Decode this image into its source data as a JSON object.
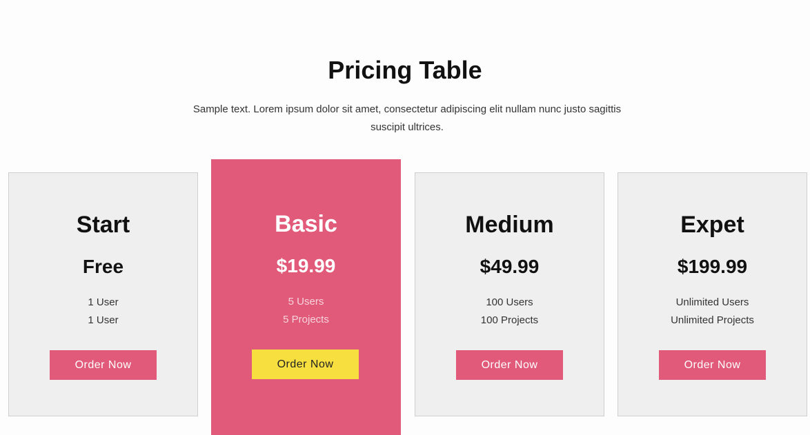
{
  "header": {
    "title": "Pricing Table",
    "subtitle": "Sample text. Lorem ipsum dolor sit amet, consectetur adipiscing elit nullam nunc justo sagittis suscipit ultrices."
  },
  "colors": {
    "accent": "#e15a79",
    "highlight_button": "#f7df3f",
    "card_background": "#efefef"
  },
  "plans": [
    {
      "name": "Start",
      "price": "Free",
      "features": [
        "1 User",
        "1 User"
      ],
      "button": "Order Now",
      "featured": false
    },
    {
      "name": "Basic",
      "price": "$19.99",
      "features": [
        "5 Users",
        "5 Projects"
      ],
      "button": "Order Now",
      "featured": true
    },
    {
      "name": "Medium",
      "price": "$49.99",
      "features": [
        "100 Users",
        "100 Projects"
      ],
      "button": "Order Now",
      "featured": false
    },
    {
      "name": "Expet",
      "price": "$199.99",
      "features": [
        "Unlimited Users",
        "Unlimited Projects"
      ],
      "button": "Order Now",
      "featured": false
    }
  ]
}
